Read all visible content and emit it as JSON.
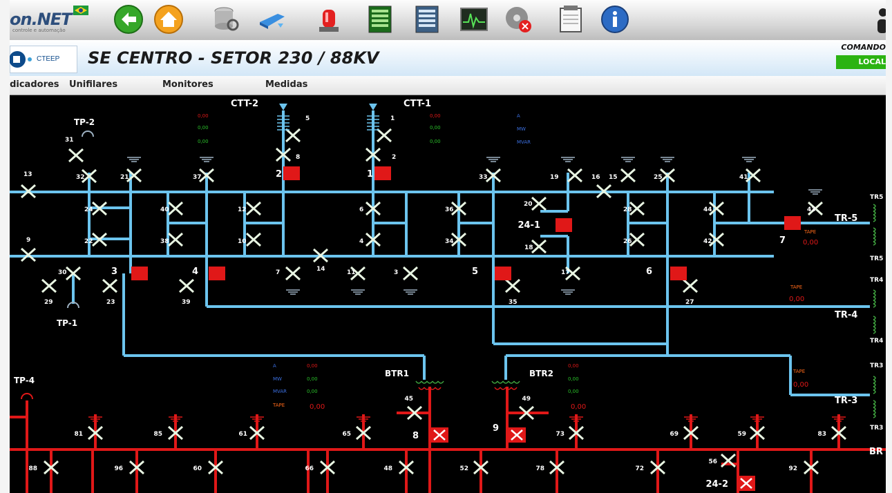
{
  "toolbar": {
    "brand": "on.NET",
    "brand_sub": "controle e automação",
    "icons": [
      "flag-brazil-icon",
      "back-arrow-icon",
      "home-icon",
      "database-search-icon",
      "network-cloud-icon",
      "alarm-siren-icon",
      "event-list-icon",
      "table-list-icon",
      "trend-monitor-icon",
      "disk-error-icon",
      "notepad-icon",
      "info-icon"
    ]
  },
  "header": {
    "logo_text": "CTEEP",
    "title": "SE CENTRO - SETOR 230 / 88KV",
    "command_label": "COMANDO",
    "command_value": "LOCAL"
  },
  "menu": {
    "items": [
      "Indicadores",
      "Unifilares",
      "Monitores",
      "Medidas"
    ]
  },
  "colors": {
    "bus_230": "#6cc4ee",
    "bus_88": "#e01818",
    "breaker_closed": "#e01818",
    "switch": "#e8f5e2",
    "background": "#000000"
  },
  "diagram": {
    "labels": {
      "tp2": "TP-2",
      "tp1": "TP-1",
      "tp4": "TP-4",
      "ctt2": "CTT-2",
      "ctt1": "CTT-1",
      "btr1": "BTR1",
      "btr2": "BTR2",
      "tr5": "TR-5",
      "tr4": "TR-4",
      "tr3": "TR-3",
      "tr5a": "TR5",
      "tr5b": "TR5",
      "tr4a": "TR4",
      "tr4b": "TR4",
      "tr3a": "TR3",
      "tr3b": "TR3",
      "br": "BR"
    },
    "breakers_230": [
      "2",
      "1",
      "24-1",
      "7",
      "3",
      "4",
      "5",
      "6"
    ],
    "breakers_88": [
      "8",
      "9",
      "24-2"
    ],
    "switches_230": [
      "31",
      "32",
      "13",
      "21",
      "37",
      "5",
      "8",
      "1",
      "2",
      "33",
      "19",
      "16",
      "15",
      "25",
      "41",
      "24",
      "40",
      "12",
      "6",
      "36",
      "20",
      "28",
      "44",
      "43",
      "22",
      "38",
      "10",
      "4",
      "34",
      "18",
      "26",
      "42",
      "9",
      "30",
      "14",
      "29",
      "23",
      "39",
      "7",
      "11",
      "3",
      "35",
      "17",
      "27"
    ],
    "switches_88": [
      "81",
      "85",
      "61",
      "65",
      "73",
      "69",
      "59",
      "83",
      "88",
      "96",
      "60",
      "66",
      "48",
      "52",
      "78",
      "72",
      "56",
      "92",
      "45",
      "49"
    ],
    "meas_ctt2": [
      "0,00",
      "0,00",
      "0,00"
    ],
    "meas_ctt1": [
      "0,00",
      "0,00",
      "0,00"
    ],
    "meas_labels_top": [
      "A",
      "MW",
      "MVAR"
    ],
    "meas_labels_btr": [
      "A",
      "MW",
      "MVAR",
      "TAPE"
    ],
    "meas_btr1": [
      "0,00",
      "0,00",
      "0,00",
      "0,00"
    ],
    "meas_btr2": [
      "0,00",
      "0,00",
      "0,00",
      "0,00"
    ],
    "tape_label": "TAPE",
    "tape_value": "0,00"
  }
}
